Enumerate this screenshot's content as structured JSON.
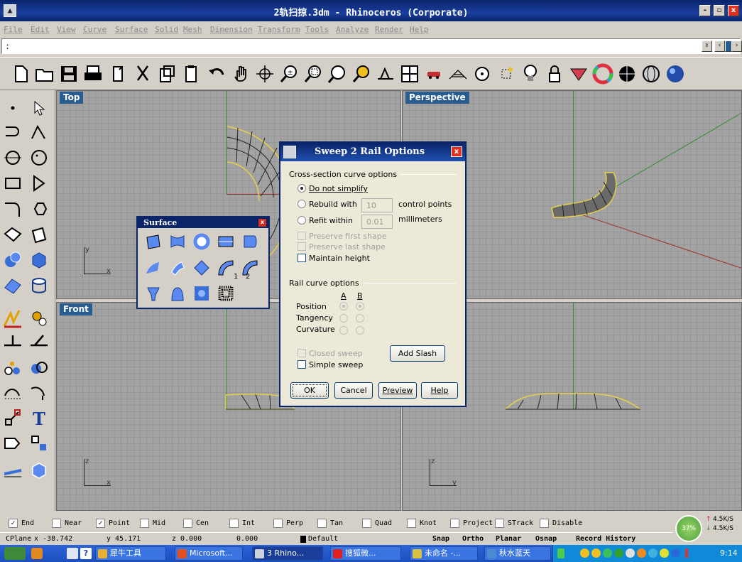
{
  "window": {
    "title": "2轨扫掠.3dm - Rhinoceros (Corporate)",
    "minimize": "-",
    "restore": "▫",
    "close": "x"
  },
  "menu": [
    "File",
    "Edit",
    "View",
    "Curve",
    "Surface",
    "Solid",
    "Mesh",
    "Dimension",
    "Transform",
    "Tools",
    "Analyze",
    "Render",
    "Help"
  ],
  "command": {
    "prompt": ":"
  },
  "viewports": {
    "top": {
      "label": "Top",
      "axis_v": "y",
      "axis_h": "x"
    },
    "perspective": {
      "label": "Perspective"
    },
    "front": {
      "label": "Front",
      "axis_v": "z",
      "axis_h": "x"
    },
    "right_bottom": {
      "axis_v": "z",
      "axis_h": "y"
    }
  },
  "surface_panel": {
    "title": "Surface",
    "close": "x",
    "badges": [
      "1",
      "2"
    ]
  },
  "dialog": {
    "title": "Sweep 2 Rail Options",
    "close": "x",
    "cross_section_group": "Cross-section curve options",
    "do_not_simplify": "Do not simplify",
    "rebuild_with": "Rebuild with",
    "rebuild_value": "10",
    "control_points": "control points",
    "refit_within": "Refit within",
    "refit_value": "0.01",
    "millimeters": "millimeters",
    "preserve_first": "Preserve first shape",
    "preserve_last": "Preserve last shape",
    "maintain_height": "Maintain height",
    "rail_group": "Rail curve options",
    "col_a": "A",
    "col_b": "B",
    "position": "Position",
    "tangency": "Tangency",
    "curvature": "Curvature",
    "closed_sweep": "Closed sweep",
    "add_slash": "Add Slash",
    "simple_sweep": "Simple sweep",
    "ok": "OK",
    "cancel": "Cancel",
    "preview": "Preview",
    "help": "Help"
  },
  "osnaps": [
    {
      "label": "End",
      "checked": true
    },
    {
      "label": "Near",
      "checked": false
    },
    {
      "label": "Point",
      "checked": true
    },
    {
      "label": "Mid",
      "checked": false
    },
    {
      "label": "Cen",
      "checked": false
    },
    {
      "label": "Int",
      "checked": false
    },
    {
      "label": "Perp",
      "checked": false
    },
    {
      "label": "Tan",
      "checked": false
    },
    {
      "label": "Quad",
      "checked": false
    },
    {
      "label": "Knot",
      "checked": false
    },
    {
      "label": "Project",
      "checked": false
    },
    {
      "label": "STrack",
      "checked": false
    },
    {
      "label": "Disable",
      "checked": false
    }
  ],
  "status": {
    "cplane": "CPlane",
    "x": "x -38.742",
    "y": "y 45.171",
    "z": "z 0.000",
    "val": "0.000",
    "layer": "Default",
    "snap": "Snap",
    "ortho": "Ortho",
    "planar": "Planar",
    "osnap": "Osnap",
    "record": "Record History"
  },
  "network": {
    "percent": "37%",
    "up": "4.5K/S",
    "down": "4.5K/S"
  },
  "taskbar": {
    "items": [
      "犀牛工具",
      "Microsoft...",
      "3 Rhino...",
      "搜狐微...",
      "未命名 -...",
      "秋水蓝天"
    ],
    "clock": "9:14"
  },
  "colors": {
    "titlebar": "#0a246a",
    "viewport_bg": "#a3a3a3",
    "viewport_label": "#2a5d8f",
    "axis_green": "#2a8a2a",
    "axis_red": "#a03030",
    "dialog_bg": "#ece9d8",
    "taskbar": "#2b62d6"
  }
}
